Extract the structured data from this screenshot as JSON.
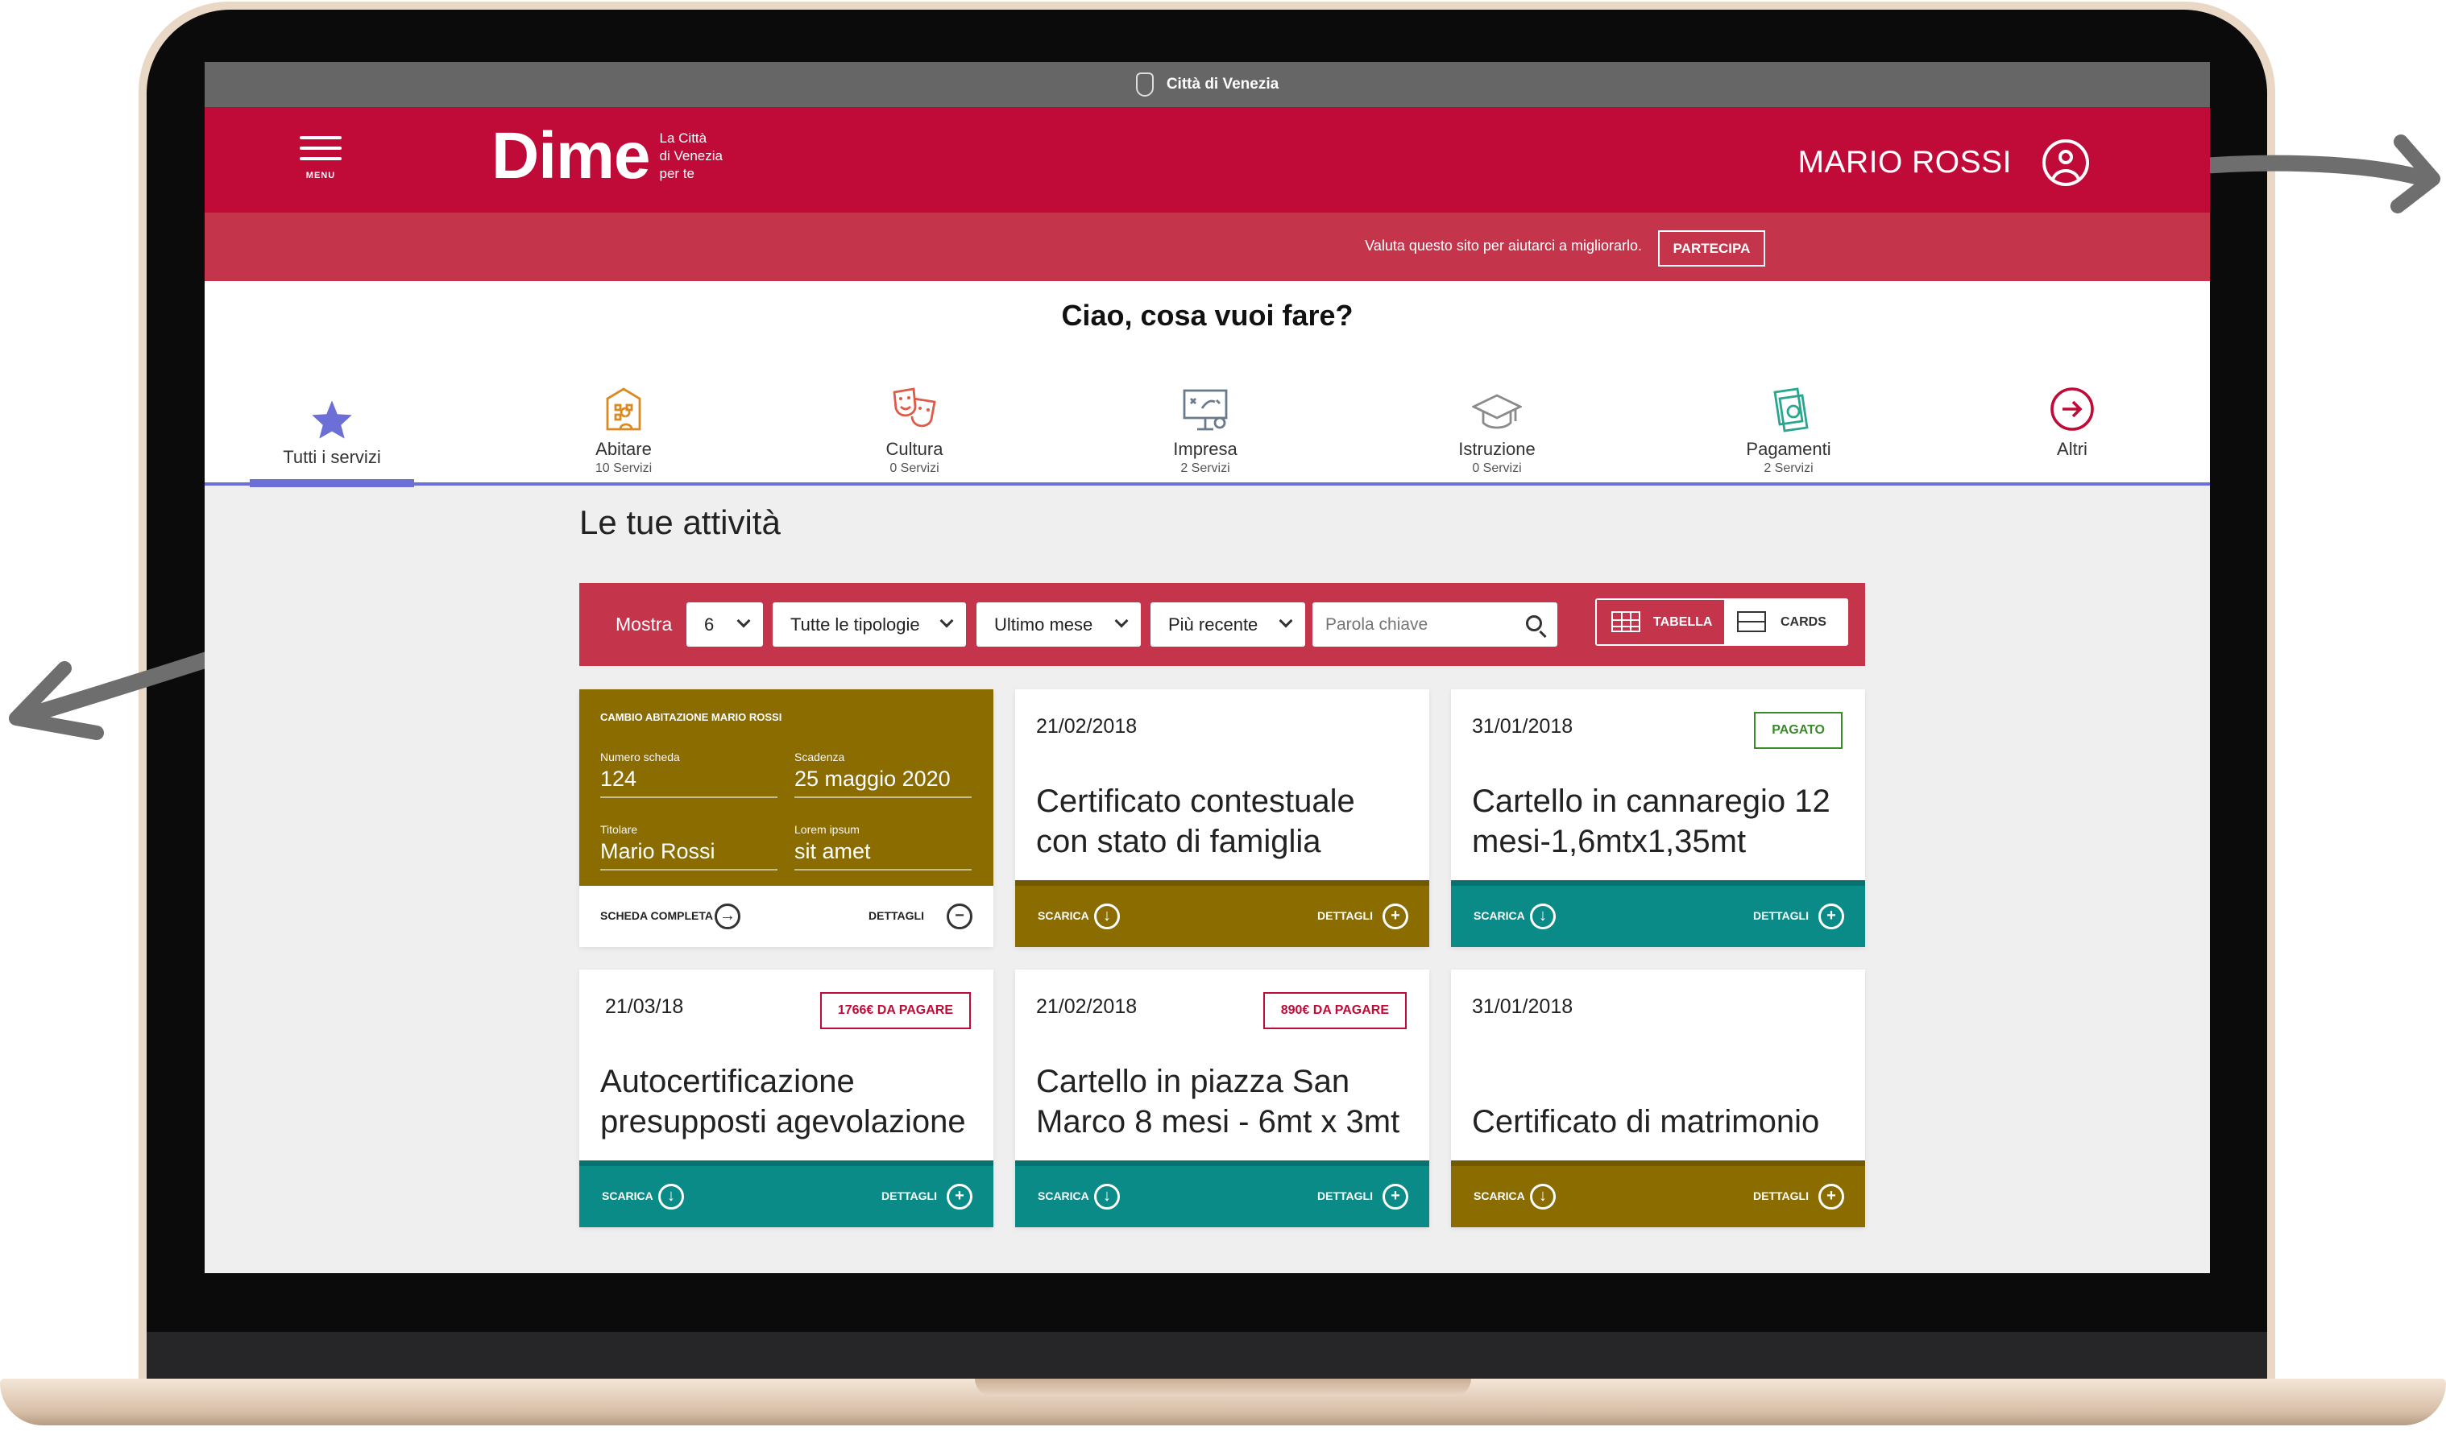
{
  "topbar": {
    "city": "Città di Venezia"
  },
  "header": {
    "menu_label": "MENU",
    "logo_word": "Dime",
    "tagline": [
      "La Città",
      "di Venezia",
      "per te"
    ],
    "user_name": "MARIO ROSSI"
  },
  "feedback": {
    "text": "Valuta questo sito per aiutarci a migliorarlo.",
    "button": "PARTECIPA"
  },
  "greeting": "Ciao, cosa vuoi fare?",
  "categories": [
    {
      "name": "Tutti i servizi",
      "count": "",
      "icon": "star-icon",
      "active": true
    },
    {
      "name": "Abitare",
      "count": "10 Servizi",
      "icon": "house-icon"
    },
    {
      "name": "Cultura",
      "count": "0 Servizi",
      "icon": "theater-masks-icon"
    },
    {
      "name": "Impresa",
      "count": "2 Servizi",
      "icon": "whiteboard-icon"
    },
    {
      "name": "Istruzione",
      "count": "0 Servizi",
      "icon": "graduation-cap-icon"
    },
    {
      "name": "Pagamenti",
      "count": "2 Servizi",
      "icon": "money-icon"
    },
    {
      "name": "Altri",
      "count": "",
      "icon": "arrow-right-circle-icon"
    }
  ],
  "section_title": "Le tue attività",
  "filters": {
    "mostra_label": "Mostra",
    "count": "6",
    "tipologie": "Tutte le tipologie",
    "periodo": "Ultimo mese",
    "ordine": "Più recente",
    "search_placeholder": "Parola chiave",
    "view_table": "TABELLA",
    "view_cards": "CARDS"
  },
  "feature_card": {
    "title": "CAMBIO ABITAZIONE MARIO ROSSI",
    "fields": [
      {
        "label": "Numero scheda",
        "value": "124"
      },
      {
        "label": "Scadenza",
        "value": "25 maggio 2020"
      },
      {
        "label": "Titolare",
        "value": "Mario Rossi"
      },
      {
        "label": "Lorem ipsum",
        "value": "sit amet"
      }
    ],
    "left_action": "SCHEDA COMPLETA",
    "right_action": "DETTAGLI"
  },
  "cards": [
    {
      "date": "21/02/2018",
      "title": "Certificato contestuale con stato di famiglia",
      "badge": "",
      "color": "gold"
    },
    {
      "date": "31/01/2018",
      "title": "Cartello in cannaregio 12 mesi-1,6mtx1,35mt",
      "badge": "PAGATO",
      "badge_type": "paid",
      "color": "teal"
    },
    {
      "date": "21/03/18",
      "title": "Autocertificazione presupposti agevolazione",
      "badge": "1766€ DA PAGARE",
      "badge_type": "due",
      "color": "teal"
    },
    {
      "date": "21/02/2018",
      "title": "Cartello in piazza San Marco 8 mesi - 6mt x 3mt",
      "badge": "890€ DA PAGARE",
      "badge_type": "due",
      "color": "teal"
    },
    {
      "date": "31/01/2018",
      "title": "Certificato di matrimonio",
      "badge": "",
      "color": "gold"
    }
  ],
  "card_actions": {
    "download": "SCARICA",
    "details": "DETTAGLI"
  },
  "colors": {
    "brand_red": "#c00a37",
    "feedback_red": "#c4344b",
    "gold": "#8b6c00",
    "teal": "#0b8b88",
    "active_blue": "#6b6fd6"
  }
}
